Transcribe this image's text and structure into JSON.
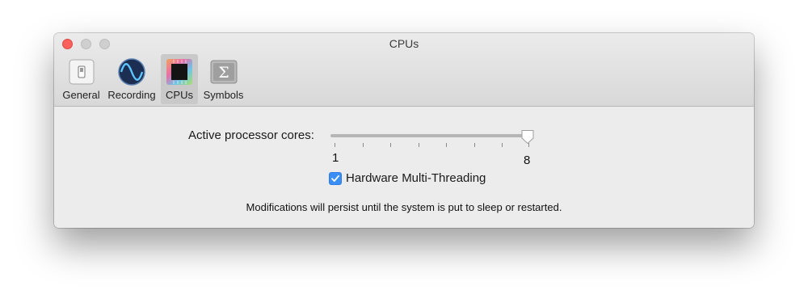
{
  "window": {
    "title": "CPUs",
    "controls": [
      "close",
      "minimize",
      "zoom"
    ]
  },
  "toolbar": {
    "tabs": [
      {
        "label": "General",
        "icon": "switch-icon"
      },
      {
        "label": "Recording",
        "icon": "waveform-icon"
      },
      {
        "label": "CPUs",
        "icon": "cpu-chip-icon",
        "selected": true
      },
      {
        "label": "Symbols",
        "icon": "sigma-icon"
      }
    ]
  },
  "cpus": {
    "cores_label": "Active processor cores:",
    "slider": {
      "min": 1,
      "max": 8,
      "value": 8,
      "min_label": "1",
      "max_label": "8"
    },
    "hyperthreading": {
      "label": "Hardware Multi-Threading",
      "checked": true
    },
    "note": "Modifications will persist until the system is put to sleep or restarted."
  },
  "colors": {
    "accent": "#3b8ef5",
    "close": "#fc605c"
  }
}
